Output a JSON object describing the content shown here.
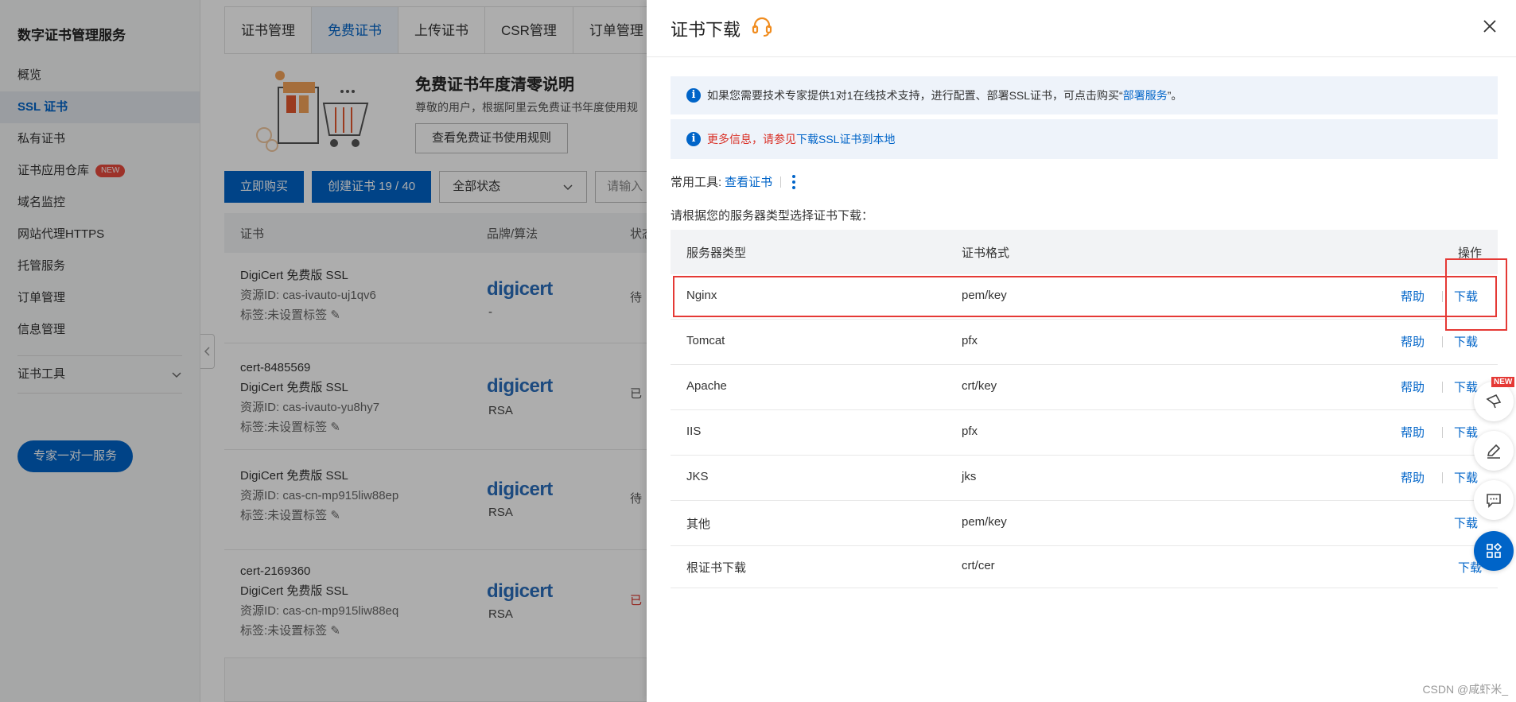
{
  "sidebar": {
    "title": "数字证书管理服务",
    "items": [
      {
        "label": "概览"
      },
      {
        "label": "SSL 证书",
        "active": true
      },
      {
        "label": "私有证书"
      },
      {
        "label": "证书应用仓库",
        "badge": "NEW"
      },
      {
        "label": "域名监控"
      },
      {
        "label": "网站代理HTTPS"
      },
      {
        "label": "托管服务"
      },
      {
        "label": "订单管理"
      },
      {
        "label": "信息管理"
      }
    ],
    "tools_label": "证书工具",
    "expert_button": "专家一对一服务"
  },
  "main": {
    "tabs": [
      "证书管理",
      "免费证书",
      "上传证书",
      "CSR管理",
      "订单管理"
    ],
    "active_tab": "免费证书",
    "promo": {
      "title": "免费证书年度清零说明",
      "text": "尊敬的用户，根据阿里云免费证书年度使用规",
      "button": "查看免费证书使用规则"
    },
    "toolbar": {
      "buy": "立即购买",
      "create": "创建证书 19 / 40",
      "status_select": "全部状态",
      "search_placeholder": "请输入"
    },
    "list_headers": [
      "证书",
      "品牌/算法",
      "状态"
    ],
    "certs": [
      {
        "name": "",
        "type": "DigiCert 免费版 SSL",
        "resource": "资源ID: cas-ivauto-uj1qv6",
        "tag": "标签:未设置标签",
        "brand": "digicert",
        "algo": "-",
        "status": "待"
      },
      {
        "name": "cert-8485569",
        "type": "DigiCert 免费版 SSL",
        "resource": "资源ID: cas-ivauto-yu8hy7",
        "tag": "标签:未设置标签",
        "brand": "digicert",
        "algo": "RSA",
        "status": "已"
      },
      {
        "name": "",
        "type": "DigiCert 免费版 SSL",
        "resource": "资源ID: cas-cn-mp915liw88ep",
        "tag": "标签:未设置标签",
        "brand": "digicert",
        "algo": "RSA",
        "status": "待"
      },
      {
        "name": "cert-2169360",
        "type": "DigiCert 免费版 SSL",
        "resource": "资源ID: cas-cn-mp915liw88eq",
        "tag": "标签:未设置标签",
        "brand": "digicert",
        "algo": "RSA",
        "status": "已"
      }
    ]
  },
  "drawer": {
    "title": "证书下载",
    "notice1": {
      "text": "如果您需要技术专家提供1对1在线技术支持，进行配置、部署SSL证书，可点击购买“",
      "link": "部署服务",
      "suffix": "”。"
    },
    "notice2": {
      "text": "更多信息，请参见",
      "link": "下载SSL证书到本地"
    },
    "tools_label": "常用工具:",
    "tools_link": "查看证书",
    "instruction": "请根据您的服务器类型选择证书下载：",
    "table": {
      "headers": [
        "服务器类型",
        "证书格式",
        "操作"
      ],
      "rows": [
        {
          "server": "Nginx",
          "format": "pem/key",
          "help": "帮助",
          "download": "下载"
        },
        {
          "server": "Tomcat",
          "format": "pfx",
          "help": "帮助",
          "download": "下载"
        },
        {
          "server": "Apache",
          "format": "crt/key",
          "help": "帮助",
          "download": "下载"
        },
        {
          "server": "IIS",
          "format": "pfx",
          "help": "帮助",
          "download": "下载"
        },
        {
          "server": "JKS",
          "format": "jks",
          "help": "帮助",
          "download": "下载"
        },
        {
          "server": "其他",
          "format": "pem/key",
          "help": "",
          "download": "下载"
        },
        {
          "server": "根证书下载",
          "format": "crt/cer",
          "help": "",
          "download": "下载"
        }
      ]
    }
  },
  "float": {
    "new_badge": "NEW"
  },
  "watermark": "CSDN @咸虾米_",
  "colors": {
    "primary": "#0064c8",
    "highlight": "#e53935",
    "badge": "#e84a3d"
  }
}
